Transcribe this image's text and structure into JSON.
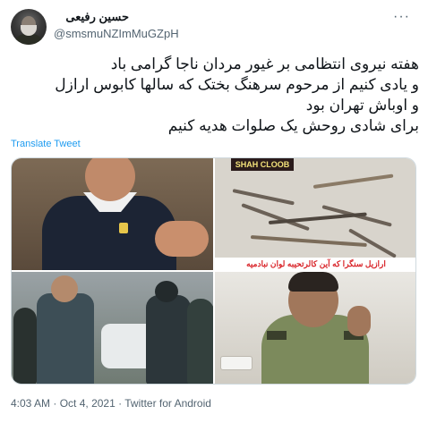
{
  "author": {
    "name": "حسین رفیعی",
    "handle": "@smsmuNZImMuGZpH"
  },
  "tweet": {
    "lines": [
      "هفته نیروی انتظامی بر غیور مردان ناجا گرامی باد",
      "و یادی کنیم از مرحوم سرهنگ بختک که سالها کابوس ارازل",
      "و اوباش تهران بود",
      "برای شادی روحش یک صلوات هدیه کنیم"
    ],
    "translate_label": "Translate Tweet"
  },
  "media": {
    "images": [
      {
        "icon": "photo-man-navy-shirt-icon"
      },
      {
        "icon": "photo-weapons-collection-icon",
        "banner": "SHAH CLOOB",
        "caption": "ارازیل سنگرا که آین کالرتحیبه لوان نبادمیه"
      },
      {
        "icon": "photo-officers-street-icon"
      },
      {
        "icon": "photo-officer-desk-icon"
      }
    ]
  },
  "meta": {
    "time": "4:03 AM",
    "separator": "·",
    "date": "Oct 4, 2021",
    "source": "Twitter for Android"
  },
  "colors": {
    "link": "#1d9bf0",
    "secondary": "#536471",
    "text": "#0f1419"
  }
}
